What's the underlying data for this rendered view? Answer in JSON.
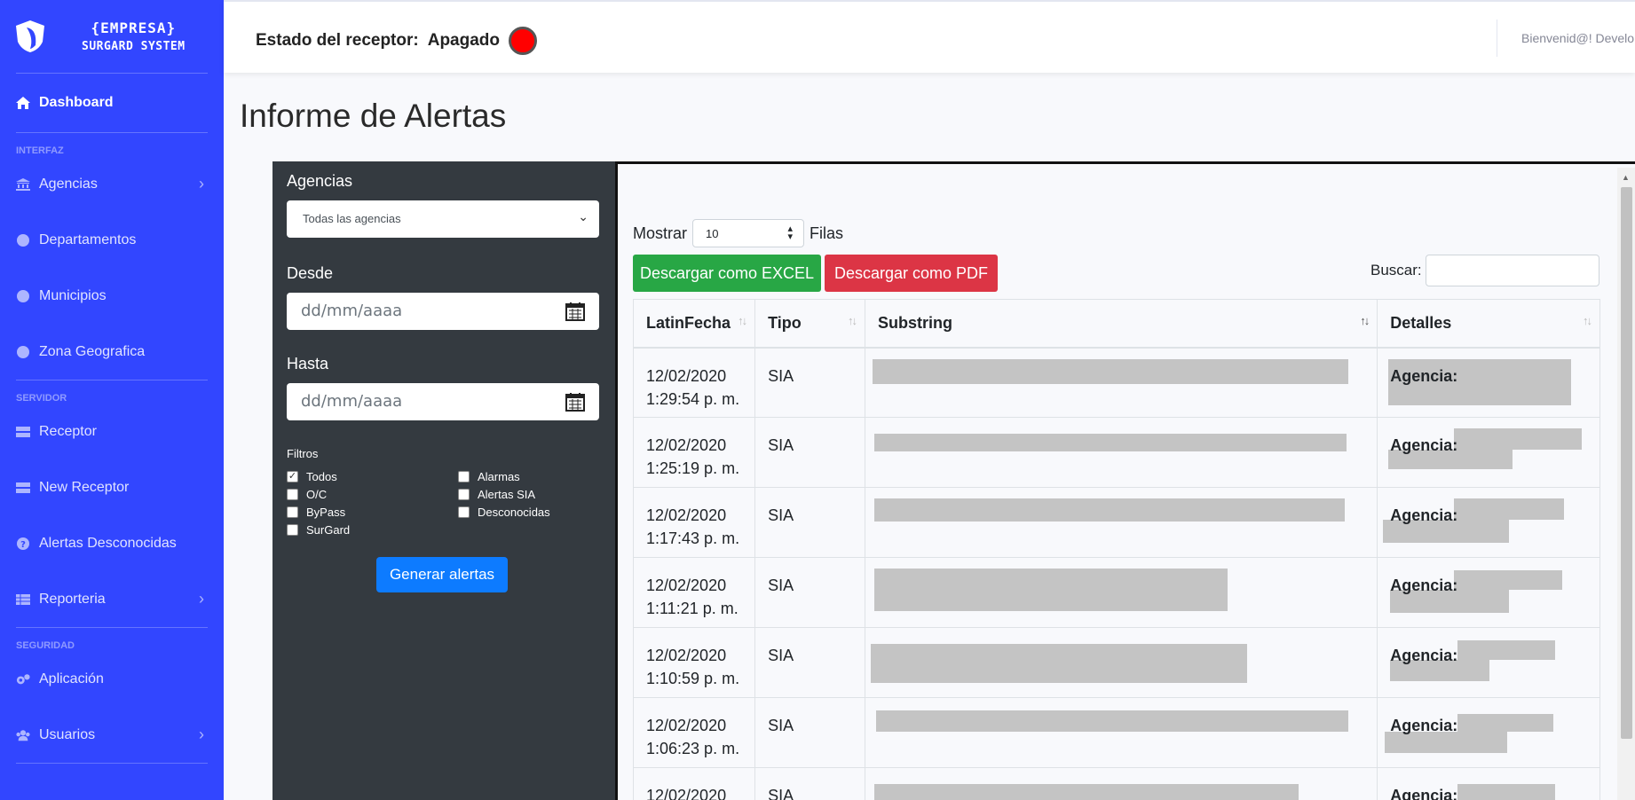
{
  "sidebar": {
    "brand_line1": "{EMPRESA}",
    "brand_line2": "SURGARD SYSTEM",
    "dashboard": "Dashboard",
    "section_interfaz": "INTERFAZ",
    "agencias": "Agencias",
    "departamentos": "Departamentos",
    "municipios": "Municipios",
    "zona": "Zona Geografica",
    "section_servidor": "SERVIDOR",
    "receptor": "Receptor",
    "new_receptor": "New Receptor",
    "alertas_desc": "Alertas Desconocidas",
    "reporteria": "Reporteria",
    "section_seguridad": "SEGURIDAD",
    "aplicacion": "Aplicación",
    "usuarios": "Usuarios"
  },
  "topbar": {
    "receiver_label": "Estado del receptor:",
    "receiver_value": "Apagado",
    "led_color": "#ff0000",
    "welcome": "Bienvenid@! Develo"
  },
  "page": {
    "title": "Informe de Alertas"
  },
  "filters": {
    "agencias_label": "Agencias",
    "agencias_value": "Todas las agencias",
    "desde_label": "Desde",
    "desde_placeholder": "dd/mm/aaaa",
    "hasta_label": "Hasta",
    "hasta_placeholder": "dd/mm/aaaa",
    "filtros_label": "Filtros",
    "todos": "Todos",
    "oc": "O/C",
    "bypass": "ByPass",
    "surgard": "SurGard",
    "alarmas": "Alarmas",
    "alertas_sia": "Alertas SIA",
    "desconocidas": "Desconocidas",
    "generate": "Generar alertas"
  },
  "table_panel": {
    "mostrar": "Mostrar",
    "page_size": "10",
    "filas": "Filas",
    "excel": "Descargar como EXCEL",
    "pdf": "Descargar como PDF",
    "buscar": "Buscar:",
    "headers": [
      "LatinFecha",
      "Tipo",
      "Substring",
      "Detalles"
    ],
    "agencia_label": "Agencia:",
    "rows": [
      {
        "date": "12/02/2020",
        "time": "1:29:54 p. m.",
        "tipo": "SIA"
      },
      {
        "date": "12/02/2020",
        "time": "1:25:19 p. m.",
        "tipo": "SIA"
      },
      {
        "date": "12/02/2020",
        "time": "1:17:43 p. m.",
        "tipo": "SIA"
      },
      {
        "date": "12/02/2020",
        "time": "1:11:21 p. m.",
        "tipo": "SIA"
      },
      {
        "date": "12/02/2020",
        "time": "1:10:59 p. m.",
        "tipo": "SIA"
      },
      {
        "date": "12/02/2020",
        "time": "1:06:23 p. m.",
        "tipo": "SIA"
      },
      {
        "date": "12/02/2020",
        "time": "",
        "tipo": "SIA"
      }
    ]
  }
}
